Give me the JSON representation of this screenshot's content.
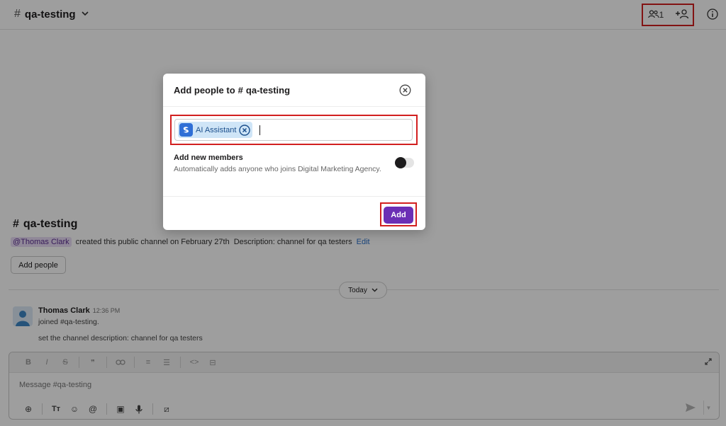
{
  "header": {
    "channel_hash": "#",
    "channel_name": "qa-testing",
    "members_count": "1",
    "icons": {
      "members": "members-icon",
      "add_member": "add-member-icon",
      "info": "info-icon",
      "chevron": "chevron-down-icon"
    }
  },
  "intro": {
    "hash": "#",
    "title": "qa-testing",
    "mention": "@Thomas Clark",
    "created_text": "created this public channel on February 27th",
    "description": "Description: channel for qa testers",
    "edit_label": "Edit",
    "add_people_label": "Add people"
  },
  "divider": {
    "label": "Today"
  },
  "message": {
    "author": "Thomas Clark",
    "time": "12:36 PM",
    "line1": "joined #qa-testing.",
    "line2": "set the channel description: channel for qa testers"
  },
  "composer": {
    "placeholder": "Message #qa-testing",
    "format_tools": [
      "B",
      "I",
      "S",
      "❞",
      "🔗",
      "≡",
      "☰",
      "<>",
      "⊟"
    ],
    "bottom_tools": [
      "⊕",
      "Tт",
      "☺",
      "@",
      "▣",
      "🎙",
      "⧄"
    ]
  },
  "modal": {
    "title_prefix": "Add people to",
    "hash": "#",
    "channel": "qa-testing",
    "chip_label": "AI Assistant",
    "toggle_title": "Add new members",
    "toggle_desc": "Automatically adds anyone who joins Digital Marketing Agency.",
    "toggle_on": false,
    "add_label": "Add"
  },
  "colors": {
    "accent": "#6b2fb5",
    "highlight_box": "#d21f1f",
    "chip_bg": "#cfe5f7",
    "link": "#2a70c9"
  }
}
